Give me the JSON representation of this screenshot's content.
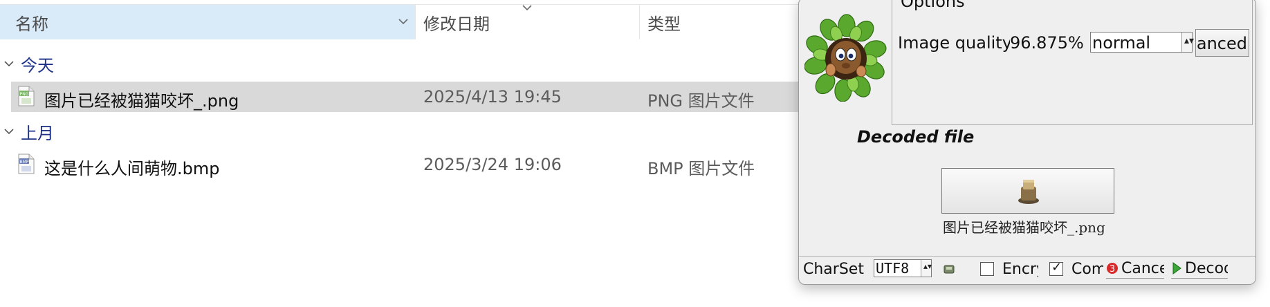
{
  "explorer": {
    "columns": {
      "name": "名称",
      "date": "修改日期",
      "type": "类型"
    },
    "groups": [
      {
        "label": "今天",
        "files": [
          {
            "name": "图片已经被猫猫咬坏_.png",
            "date": "2025/4/13 19:45",
            "type": "PNG 图片文件",
            "icon": "png-file-icon",
            "selected": true
          }
        ]
      },
      {
        "label": "上月",
        "files": [
          {
            "name": "这是什么人间萌物.bmp",
            "date": "2025/3/24 19:06",
            "type": "BMP 图片文件",
            "icon": "bmp-file-icon",
            "selected": false
          }
        ]
      }
    ],
    "icon_labels": {
      "png": "PNG",
      "bmp": "BMP"
    }
  },
  "dialog": {
    "options_title": "Options",
    "image_quality_label": "Image quality",
    "image_quality_value": "96.875%",
    "quality_mode": "normal",
    "advanced_button": "Advanced",
    "decoded_label": "Decoded file",
    "decoded_filename": "图片已经被猫猫咬坏_.png",
    "charset_label": "CharSet",
    "charset_value": "UTF8",
    "encrypt_label": "Encrypt",
    "encrypt_checked": false,
    "compress_label": "Compress",
    "compress_checked": true,
    "cancel_button": "Cancel",
    "decode_button": "Decode"
  },
  "colors": {
    "header_bg": "#d9eaf8",
    "selected_row": "#d9d9d9",
    "group_text": "#1e3287",
    "dialog_bg": "#efefef"
  }
}
